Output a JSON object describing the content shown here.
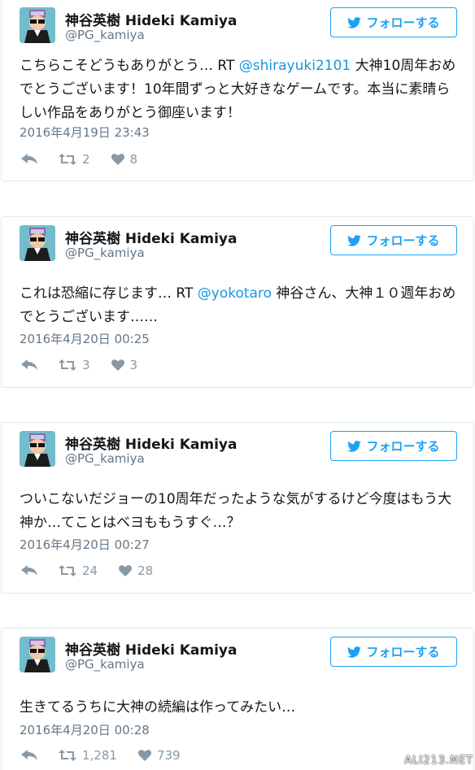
{
  "account": {
    "display_name": "神谷英樹 Hideki Kamiya",
    "handle": "@PG_kamiya"
  },
  "follow_label": "フォローする",
  "colors": {
    "accent": "#1da1f2",
    "link": "#1b95e0",
    "muted": "#657786",
    "border": "#e1e8ed"
  },
  "tweets": [
    {
      "text_before": "こちらこそどうもありがとう… RT ",
      "mention": "@shirayuki2101",
      "text_after": " 大神10周年おめでとうございます！10年間ずっと大好きなゲームです。本当に素晴らしい作品をありがとう御座います！",
      "timestamp": "2016年4月19日 23:43",
      "retweets": "2",
      "likes": "8"
    },
    {
      "text_before": "これは恐縮に存じます… RT ",
      "mention": "@yokotaro",
      "text_after": " 神谷さん、大神１０週年おめでとうございます……",
      "timestamp": "2016年4月20日 00:25",
      "retweets": "3",
      "likes": "3"
    },
    {
      "text_before": "ついこないだジョーの10周年だったような気がするけど今度はもう大神か…てことはベヨももうすぐ…？",
      "mention": "",
      "text_after": "",
      "timestamp": "2016年4月20日 00:27",
      "retweets": "24",
      "likes": "28"
    },
    {
      "text_before": "生きてるうちに大神の続編は作ってみたい…",
      "mention": "",
      "text_after": "",
      "timestamp": "2016年4月20日 00:28",
      "retweets": "1,281",
      "likes": "739"
    }
  ],
  "watermark": "ALI213.NET"
}
